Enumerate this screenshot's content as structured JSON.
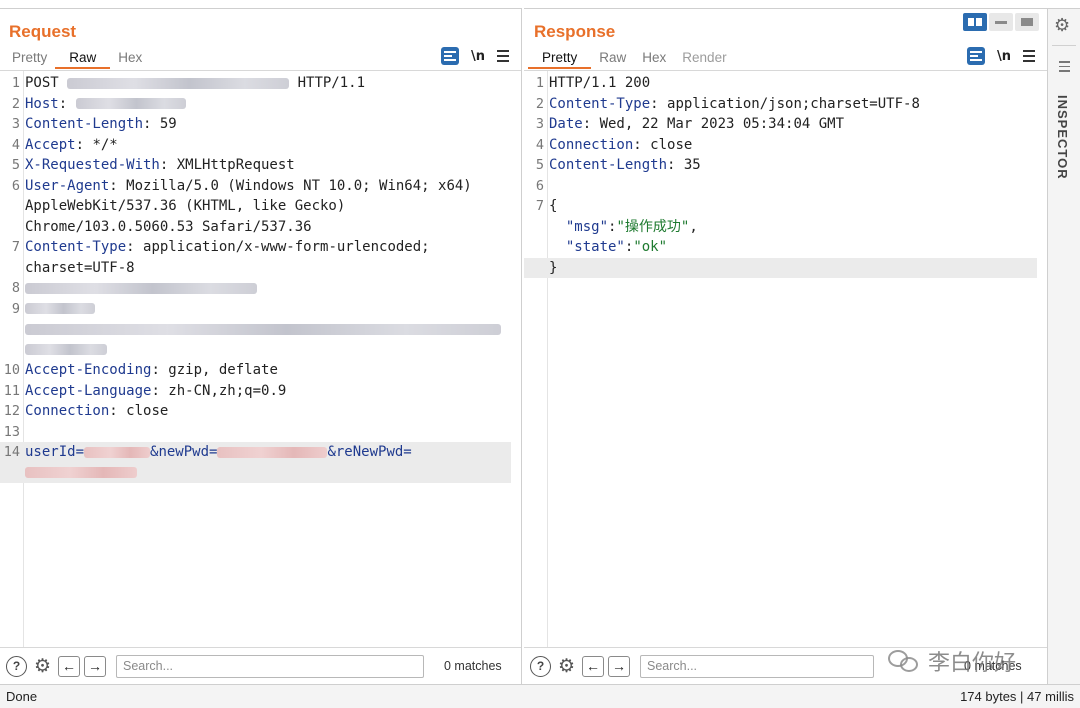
{
  "request": {
    "title": "Request",
    "tabs": [
      "Pretty",
      "Raw",
      "Hex"
    ],
    "newline_label": "\\n",
    "lines": {
      "l1": {
        "method": "POST",
        "version": "HTTP/1.1"
      },
      "l2": {
        "name": "Host"
      },
      "l3": {
        "name": "Content-Length",
        "value": "59"
      },
      "l4": {
        "name": "Accept",
        "value": "*/*"
      },
      "l5": {
        "name": "X-Requested-With",
        "value": "XMLHttpRequest"
      },
      "l6": {
        "name": "User-Agent",
        "value": "Mozilla/5.0 (Windows NT 10.0; Win64; x64) AppleWebKit/537.36 (KHTML, like Gecko) Chrome/103.0.5060.53 Safari/537.36"
      },
      "l7": {
        "name": "Content-Type",
        "value": "application/x-www-form-urlencoded; charset=UTF-8"
      },
      "l10": {
        "name": "Accept-Encoding",
        "value": "gzip, deflate"
      },
      "l11": {
        "name": "Accept-Language",
        "value": "zh-CN,zh;q=0.9"
      },
      "l12": {
        "name": "Connection",
        "value": "close"
      },
      "l14": {
        "p1": "userId=",
        "p2": "&newPwd=",
        "p3": "&reNewPwd="
      }
    },
    "search_placeholder": "Search...",
    "matches": "0 matches"
  },
  "response": {
    "title": "Response",
    "tabs": [
      "Pretty",
      "Raw",
      "Hex",
      "Render"
    ],
    "newline_label": "\\n",
    "lines": {
      "l1": "HTTP/1.1 200",
      "l2": {
        "name": "Content-Type",
        "value": "application/json;charset=UTF-8"
      },
      "l3": {
        "name": "Date",
        "value": "Wed, 22 Mar 2023 05:34:04 GMT"
      },
      "l4": {
        "name": "Connection",
        "value": "close"
      },
      "l5": {
        "name": "Content-Length",
        "value": "35"
      },
      "l7": "{",
      "l8": {
        "key": "\"msg\"",
        "value": "\"操作成功\""
      },
      "l9": {
        "key": "\"state\"",
        "value": "\"ok\""
      },
      "l10": "}"
    },
    "search_placeholder": "Search...",
    "matches": "0 matches"
  },
  "inspector": {
    "label": "INSPECTOR"
  },
  "status": {
    "left": "Done",
    "right": "174 bytes | 47 millis"
  },
  "watermark": "李白你好",
  "colors": {
    "accent": "#e8702a",
    "active_blue": "#2b6cb0",
    "header_name": "#1f3a8f",
    "json_string": "#1e7a2f"
  }
}
